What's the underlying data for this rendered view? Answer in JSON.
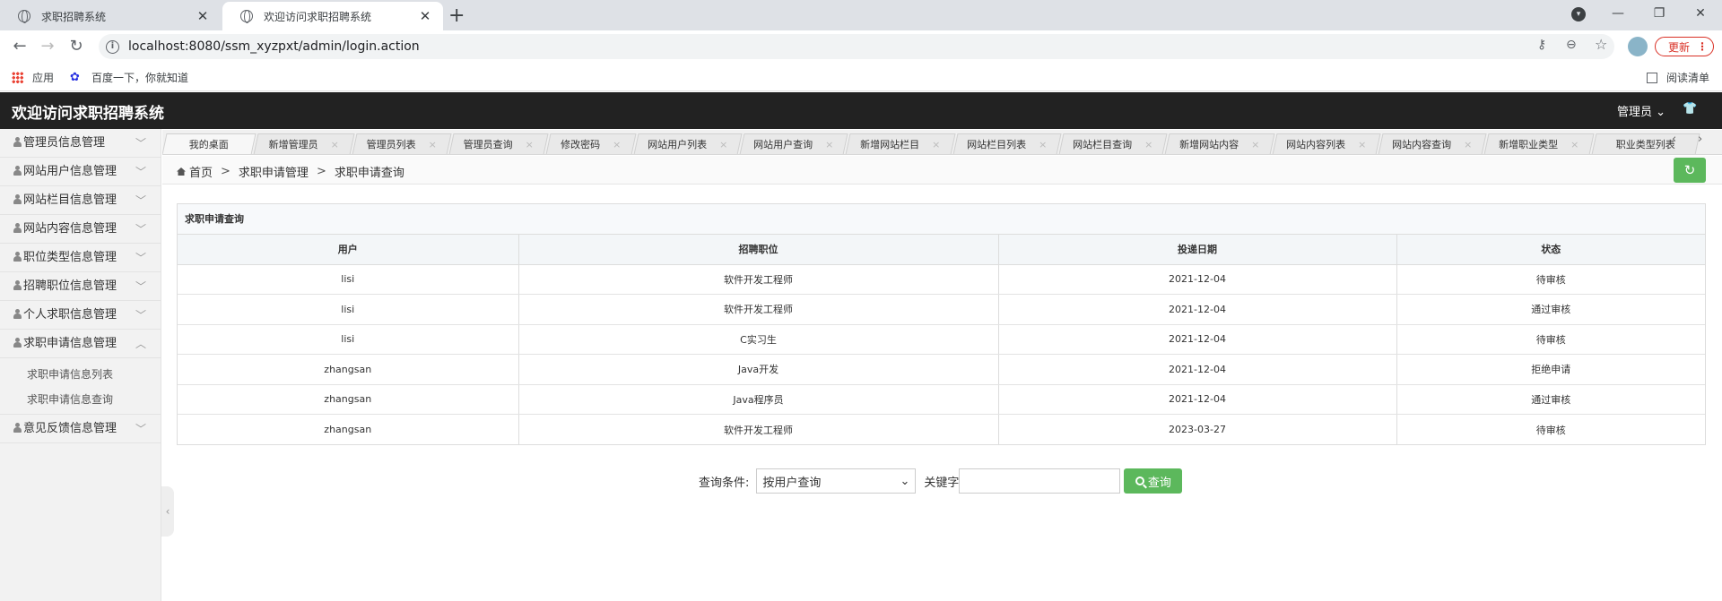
{
  "browser": {
    "tabs": [
      {
        "title": "求职招聘系统"
      },
      {
        "title": "欢迎访问求职招聘系统"
      }
    ],
    "url": "localhost:8080/ssm_xyzpxt/admin/login.action",
    "update_label": "更新",
    "bookmarks": [
      {
        "label": "应用"
      },
      {
        "label": "百度一下，你就知道"
      }
    ],
    "reading_list": "阅读清单"
  },
  "header": {
    "title": "欢迎访问求职招聘系统",
    "user_menu": "管理员"
  },
  "sidebar": {
    "items": [
      {
        "label": "管理员信息管理"
      },
      {
        "label": "网站用户信息管理"
      },
      {
        "label": "网站栏目信息管理"
      },
      {
        "label": "网站内容信息管理"
      },
      {
        "label": "职位类型信息管理"
      },
      {
        "label": "招聘职位信息管理"
      },
      {
        "label": "个人求职信息管理"
      },
      {
        "label": "求职申请信息管理"
      },
      {
        "label": "意见反馈信息管理"
      }
    ],
    "submenu": [
      "求职申请信息列表",
      "求职申请信息查询"
    ]
  },
  "content_tabs": [
    "我的桌面",
    "新增管理员",
    "管理员列表",
    "管理员查询",
    "修改密码",
    "网站用户列表",
    "网站用户查询",
    "新增网站栏目",
    "网站栏目列表",
    "网站栏目查询",
    "新增网站内容",
    "网站内容列表",
    "网站内容查询",
    "新增职业类型",
    "职业类型列表"
  ],
  "breadcrumb": {
    "home": "首页",
    "level1": "求职申请管理",
    "level2": "求职申请查询"
  },
  "panel": {
    "title": "求职申请查询",
    "columns": [
      "用户",
      "招聘职位",
      "投递日期",
      "状态"
    ],
    "rows": [
      [
        "lisi",
        "软件开发工程师",
        "2021-12-04",
        "待审核"
      ],
      [
        "lisi",
        "软件开发工程师",
        "2021-12-04",
        "通过审核"
      ],
      [
        "lisi",
        "C实习生",
        "2021-12-04",
        "待审核"
      ],
      [
        "zhangsan",
        "Java开发",
        "2021-12-04",
        "拒绝申请"
      ],
      [
        "zhangsan",
        "Java程序员",
        "2021-12-04",
        "通过审核"
      ],
      [
        "zhangsan",
        "软件开发工程师",
        "2023-03-27",
        "待审核"
      ]
    ]
  },
  "search": {
    "condition_label": "查询条件:",
    "condition_value": "按用户查询",
    "keyword_label": "关键字",
    "keyword_value": "",
    "button": "查询"
  },
  "colors": {
    "header_bg": "#222222",
    "button_green": "#5cb85c",
    "sidebar_bg": "#f2f2f2"
  }
}
